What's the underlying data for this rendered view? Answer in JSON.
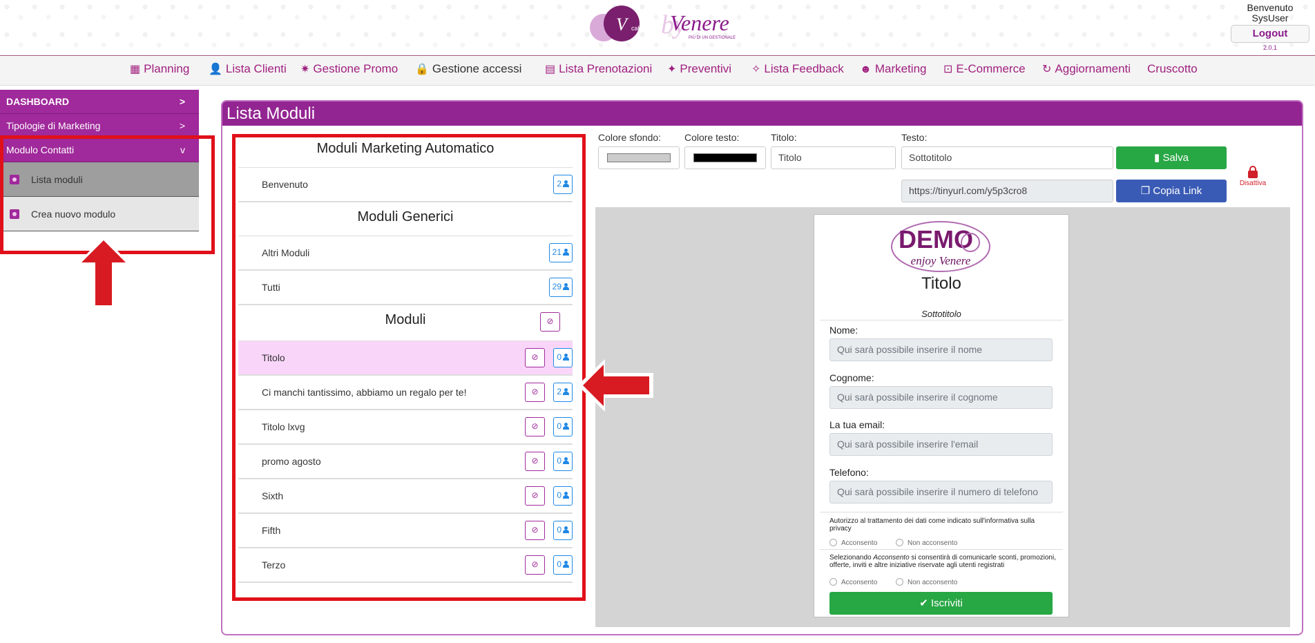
{
  "header": {
    "logo_brand": "Venere",
    "logo_small": "calendar",
    "logo_tagline": "PIÙ DI UN GESTIONALE",
    "welcome_line1": "Benvenuto",
    "welcome_line2": "SysUser",
    "logout_label": "Logout",
    "version": "2.0.1"
  },
  "nav": {
    "items": [
      {
        "label": "Planning",
        "icon": "calendar-icon",
        "glyph": "▦"
      },
      {
        "label": "Lista Clienti",
        "icon": "user-icon",
        "glyph": "👤"
      },
      {
        "label": "Gestione Promo",
        "icon": "gear-icon",
        "glyph": "✷"
      },
      {
        "label": "Gestione accessi",
        "icon": "lock-icon",
        "glyph": "🔒"
      },
      {
        "label": "Lista Prenotazioni",
        "icon": "chat-icon",
        "glyph": "▤"
      },
      {
        "label": "Preventivi",
        "icon": "stars-icon",
        "glyph": "✦"
      },
      {
        "label": "Lista Feedback",
        "icon": "stars-icon",
        "glyph": "✧"
      },
      {
        "label": "Marketing",
        "icon": "alien-icon",
        "glyph": "☻"
      },
      {
        "label": "E-Commerce",
        "icon": "cart-icon",
        "glyph": "⊡"
      },
      {
        "label": "Aggiornamenti",
        "icon": "refresh-icon",
        "glyph": "↻"
      },
      {
        "label": "Cruscotto",
        "icon": "",
        "glyph": ""
      }
    ]
  },
  "sidebar": {
    "dashboard": "DASHBOARD",
    "dashboard_chevron": ">",
    "tipologie": "Tipologie di Marketing",
    "tipologie_chevron": ">",
    "modulo_contatti": "Modulo Contatti",
    "modulo_contatti_chevron": "v",
    "sub_items": [
      "Lista moduli",
      "Crea nuovo modulo"
    ]
  },
  "panel": {
    "title": "Lista Moduli",
    "sections": {
      "automatico": "Moduli Marketing Automatico",
      "generici": "Moduli Generici",
      "moduli": "Moduli"
    },
    "automatico_rows": [
      {
        "label": "Benvenuto",
        "count": "2"
      }
    ],
    "generici_rows": [
      {
        "label": "Altri Moduli",
        "count": "21"
      },
      {
        "label": "Tutti",
        "count": "29"
      }
    ],
    "moduli_rows": [
      {
        "label": "Titolo",
        "count": "0"
      },
      {
        "label": "Ci manchi tantissimo, abbiamo un regalo per te!",
        "count": "2"
      },
      {
        "label": "Titolo lxvg",
        "count": "0"
      },
      {
        "label": "promo agosto",
        "count": "0"
      },
      {
        "label": "Sixth",
        "count": "0"
      },
      {
        "label": "Fifth",
        "count": "0"
      },
      {
        "label": "Terzo",
        "count": "0"
      }
    ]
  },
  "editor": {
    "bg_color_label": "Colore sfondo:",
    "bg_color_value": "#cccccc",
    "text_color_label": "Colore testo:",
    "text_color_value": "#000000",
    "title_label": "Titolo:",
    "title_value": "Titolo",
    "text_label": "Testo:",
    "text_value": "Sottotitolo",
    "save_label": "Salva",
    "link_value": "https://tinyurl.com/y5p3cro8",
    "copy_link_label": "Copia Link",
    "deactivate_label": "Disattiva"
  },
  "preview": {
    "logo_text": "DEMO",
    "logo_sub": "enjoy Venere",
    "title": "Titolo",
    "subtitle": "Sottotitolo",
    "fields": [
      {
        "label": "Nome:",
        "placeholder": "Qui sarà possibile inserire il nome"
      },
      {
        "label": "Cognome:",
        "placeholder": "Qui sarà possibile inserire il cognome"
      },
      {
        "label": "La tua email:",
        "placeholder": "Qui sarà possibile inserire l'email"
      },
      {
        "label": "Telefono:",
        "placeholder": "Qui sarà possibile inserire il numero di telefono"
      }
    ],
    "privacy_text": "Autorizzo al trattamento dei dati come indicato sull'informativa sulla privacy",
    "consent_yes": "Acconsento",
    "consent_no": "Non acconsento",
    "marketing_text_a": "Selezionando ",
    "marketing_text_em": "Acconsento",
    "marketing_text_b": " si consentirà di comunicarle sconti, promozioni, offerte, inviti e altre iniziative riservate agli utenti registrati",
    "submit_label": "Iscriviti"
  },
  "colors": {
    "brand": "#a0299b",
    "header": "#932592",
    "annotation": "#e0101a",
    "save": "#28a745",
    "copy": "#3a5bb5"
  }
}
